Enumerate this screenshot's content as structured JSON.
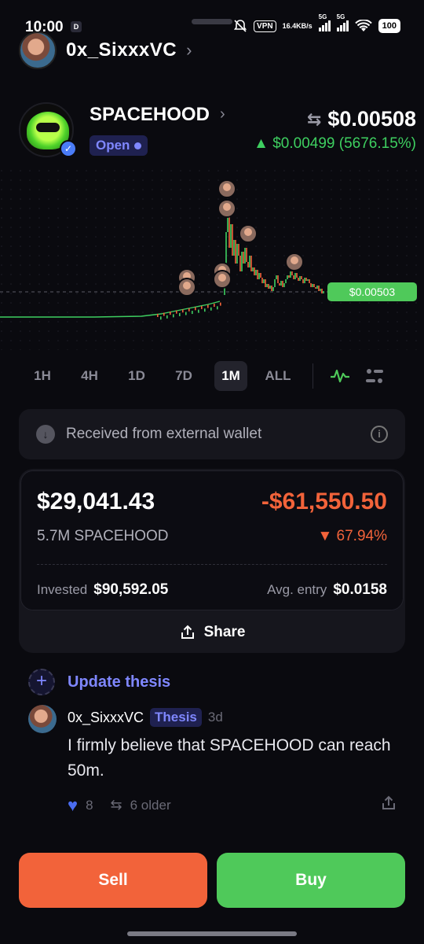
{
  "status_bar": {
    "time": "10:00",
    "mini_icon": "D",
    "vpn": "VPN",
    "net_speed_value": "16.4",
    "net_speed_unit": "KB/s",
    "signal_1_tag": "5G",
    "signal_2_tag": "5G",
    "battery": "100"
  },
  "header": {
    "owner_name": "0x_SixxxVC"
  },
  "token": {
    "name": "SPACEHOOD",
    "status": "Open",
    "price": "$0.00508",
    "change": "▲ $0.00499 (5676.15%)"
  },
  "chart": {
    "current_price_label": "$0.00503"
  },
  "timeframes": [
    "1H",
    "4H",
    "1D",
    "7D",
    "1M",
    "ALL"
  ],
  "active_timeframe": "1M",
  "banner": {
    "text": "Received from external wallet"
  },
  "position": {
    "value": "$29,041.43",
    "pnl": "-$61,550.50",
    "amount": "5.7M SPACEHOOD",
    "pnl_pct": "▼ 67.94%",
    "invested_label": "Invested",
    "invested_value": "$90,592.05",
    "avg_entry_label": "Avg. entry",
    "avg_entry_value": "$0.0158",
    "share_label": "Share"
  },
  "thesis": {
    "update_label": "Update thesis",
    "comment": {
      "user": "0x_SixxxVC",
      "tag": "Thesis",
      "time": "3d",
      "body": "I firmly believe that SPACEHOOD can reach 50m.",
      "likes": "8",
      "older": "6 older"
    }
  },
  "actions": {
    "sell": "Sell",
    "buy": "Buy"
  },
  "colors": {
    "accent": "#7f87ff",
    "positive": "#4fc95a",
    "negative": "#f2633a",
    "background": "#0a0a0f"
  }
}
